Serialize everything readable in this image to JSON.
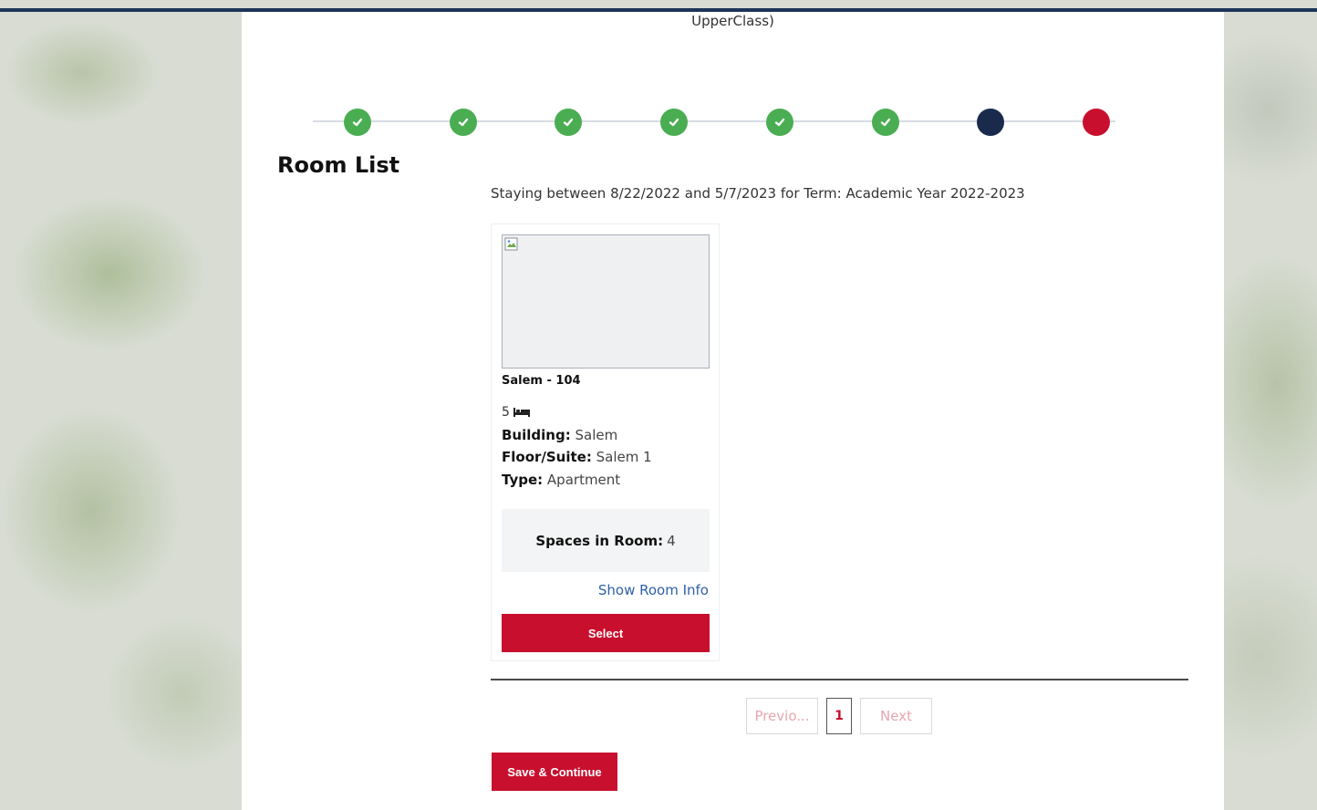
{
  "header": {
    "title_fragment": "UpperClass)"
  },
  "stepper": {
    "colors": {
      "done": "#4aad52",
      "current": "#1a2a4d",
      "todo": "#c8102e"
    },
    "steps": [
      {
        "status": "done"
      },
      {
        "status": "done"
      },
      {
        "status": "done"
      },
      {
        "status": "done"
      },
      {
        "status": "done"
      },
      {
        "status": "done"
      },
      {
        "status": "current"
      },
      {
        "status": "todo"
      }
    ]
  },
  "page": {
    "title": "Room List",
    "stay_text": "Staying between 8/22/2022 and 5/7/2023 for Term: Academic Year 2022-2023"
  },
  "room": {
    "name": "Salem - 104",
    "beds": "5",
    "bed_icon": "bed-icon",
    "building_label": "Building:",
    "building": "Salem",
    "floor_label": "Floor/Suite:",
    "floor": "Salem 1",
    "type_label": "Type:",
    "type": "Apartment",
    "spaces_label": "Spaces in Room:",
    "spaces": "4",
    "show_info": "Show Room Info",
    "select_label": "Select"
  },
  "pagination": {
    "prev_label": "Previo...",
    "page": "1",
    "next_label": "Next"
  },
  "footer": {
    "save_label": "Save & Continue"
  },
  "colors": {
    "accent": "#c8102e",
    "link": "#2e5fa8",
    "topbar": "#1d3559"
  }
}
